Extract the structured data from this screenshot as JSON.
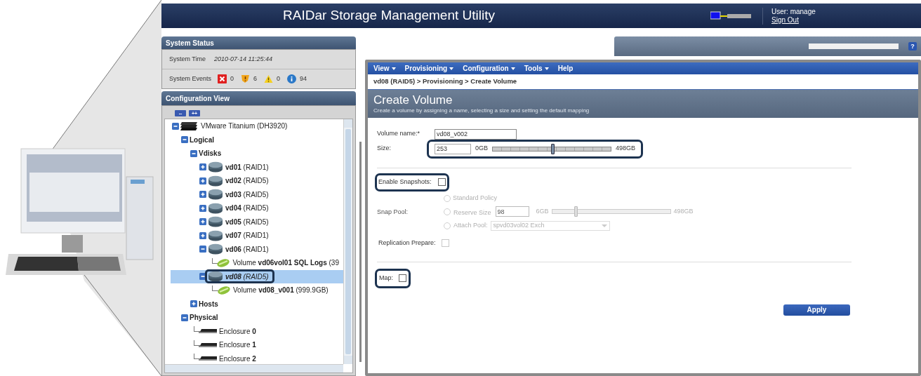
{
  "header": {
    "title": "RAIDar Storage Management Utility",
    "user": "User: manage",
    "sign_out": "Sign Out"
  },
  "system_status": {
    "title": "System Status",
    "time_label": "System Time",
    "time_value": "2010-07-14 11:25:44",
    "events_label": "System Events",
    "events": [
      {
        "kind": "critical",
        "count": "0"
      },
      {
        "kind": "error",
        "count": "6"
      },
      {
        "kind": "warning",
        "count": "0"
      },
      {
        "kind": "info",
        "count": "94"
      }
    ]
  },
  "configuration_view": {
    "title": "Configuration View",
    "collapse_all": "--",
    "expand_all": "++",
    "tree": [
      {
        "label": "VMware Titanium (DH3920)",
        "kind": "system",
        "expanded": true,
        "selected": false,
        "highlighted": false,
        "children": [
          {
            "label": "Logical",
            "kind": "folder",
            "expanded": true,
            "selected": false,
            "highlighted": false,
            "children": [
              {
                "label": "Vdisks",
                "kind": "folder",
                "expanded": true,
                "selected": false,
                "highlighted": false,
                "children": [
                  {
                    "label": "**vd01** (RAID1)",
                    "kind": "vdisk",
                    "expanded": false,
                    "selected": false,
                    "highlighted": false
                  },
                  {
                    "label": "**vd02** (RAID5)",
                    "kind": "vdisk",
                    "expanded": false,
                    "selected": false,
                    "highlighted": false
                  },
                  {
                    "label": "**vd03** (RAID5)",
                    "kind": "vdisk",
                    "expanded": false,
                    "selected": false,
                    "highlighted": false
                  },
                  {
                    "label": "**vd04** (RAID5)",
                    "kind": "vdisk",
                    "expanded": false,
                    "selected": false,
                    "highlighted": false
                  },
                  {
                    "label": "**vd05** (RAID5)",
                    "kind": "vdisk",
                    "expanded": false,
                    "selected": false,
                    "highlighted": false
                  },
                  {
                    "label": "**vd07** (RAID1)",
                    "kind": "vdisk",
                    "expanded": false,
                    "selected": false,
                    "highlighted": false
                  },
                  {
                    "label": "**vd06** (RAID1)",
                    "kind": "vdisk",
                    "expanded": true,
                    "selected": false,
                    "highlighted": false,
                    "children": [
                      {
                        "label": "Volume **vd06vol01 SQL Logs** (39",
                        "kind": "volume",
                        "selected": false,
                        "highlighted": false
                      }
                    ]
                  },
                  {
                    "label": "**vd08** (RAID5)",
                    "kind": "vdisk",
                    "expanded": true,
                    "selected": true,
                    "highlighted": true,
                    "children": [
                      {
                        "label": "Volume **vd08_v001** (999.9GB)",
                        "kind": "volume",
                        "selected": false,
                        "highlighted": false
                      }
                    ]
                  }
                ]
              },
              {
                "label": "Hosts",
                "kind": "folder",
                "expanded": false,
                "selected": false,
                "highlighted": false
              }
            ]
          },
          {
            "label": "Physical",
            "kind": "folder",
            "expanded": true,
            "selected": false,
            "highlighted": false,
            "children": [
              {
                "label": "Enclosure **0**",
                "kind": "enclosure",
                "selected": false,
                "highlighted": false
              },
              {
                "label": "Enclosure **1**",
                "kind": "enclosure",
                "selected": false,
                "highlighted": false
              },
              {
                "label": "Enclosure **2**",
                "kind": "enclosure",
                "selected": false,
                "highlighted": false
              }
            ]
          }
        ]
      }
    ]
  },
  "help": "?",
  "menu": [
    "View",
    "Provisioning",
    "Configuration",
    "Tools",
    "Help"
  ],
  "menu_dropdown": [
    true,
    true,
    true,
    true,
    false
  ],
  "breadcrumb": "vd08 (RAID5) > Provisioning > Create Volume",
  "page": {
    "title": "Create Volume",
    "description": "Create a volume by assigning a name, selecting a size and setting the default mapping"
  },
  "form": {
    "volume_name": {
      "label": "Volume name:*",
      "value": "vd08_v002"
    },
    "size": {
      "label": "Size:",
      "value": "253",
      "min": "0GB",
      "max": "498GB",
      "level": 0.51,
      "highlighted": true
    },
    "enable_snapshots": {
      "label": "Enable Snapshots:",
      "checked": false,
      "highlighted": true
    },
    "snap_pool": {
      "label": "Snap Pool:",
      "disabled": true,
      "options": [
        {
          "kind": "plain",
          "label": "Standard Policy",
          "selected": false
        },
        {
          "kind": "slider",
          "label": "Reserve Size",
          "selected": false,
          "value": "98",
          "min": "6GB",
          "max": "498GB",
          "level": 0.2
        },
        {
          "kind": "select",
          "label": "Attach Pool:",
          "selected": false,
          "value": "spvd03vol02 Exch"
        }
      ]
    },
    "replication_prepare": {
      "label": "Replication Prepare:",
      "checked": false,
      "disabled": true
    },
    "map": {
      "label": "Map:",
      "checked": false,
      "highlighted": true
    },
    "apply": "Apply"
  }
}
